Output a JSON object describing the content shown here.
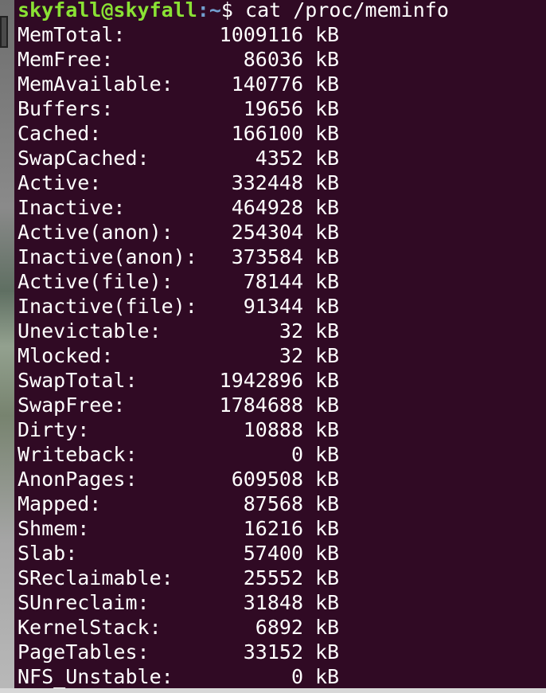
{
  "prompt": {
    "user_host": "skyfall@skyfall",
    "separator": ":",
    "path": "~",
    "symbol": "$",
    "command": " cat /proc/meminfo"
  },
  "meminfo": [
    {
      "key": "MemTotal:",
      "value": "1009116",
      "unit": "kB"
    },
    {
      "key": "MemFree:",
      "value": "86036",
      "unit": "kB"
    },
    {
      "key": "MemAvailable:",
      "value": "140776",
      "unit": "kB"
    },
    {
      "key": "Buffers:",
      "value": "19656",
      "unit": "kB"
    },
    {
      "key": "Cached:",
      "value": "166100",
      "unit": "kB"
    },
    {
      "key": "SwapCached:",
      "value": "4352",
      "unit": "kB"
    },
    {
      "key": "Active:",
      "value": "332448",
      "unit": "kB"
    },
    {
      "key": "Inactive:",
      "value": "464928",
      "unit": "kB"
    },
    {
      "key": "Active(anon):",
      "value": "254304",
      "unit": "kB"
    },
    {
      "key": "Inactive(anon):",
      "value": "373584",
      "unit": "kB"
    },
    {
      "key": "Active(file):",
      "value": "78144",
      "unit": "kB"
    },
    {
      "key": "Inactive(file):",
      "value": "91344",
      "unit": "kB"
    },
    {
      "key": "Unevictable:",
      "value": "32",
      "unit": "kB"
    },
    {
      "key": "Mlocked:",
      "value": "32",
      "unit": "kB"
    },
    {
      "key": "SwapTotal:",
      "value": "1942896",
      "unit": "kB"
    },
    {
      "key": "SwapFree:",
      "value": "1784688",
      "unit": "kB"
    },
    {
      "key": "Dirty:",
      "value": "10888",
      "unit": "kB"
    },
    {
      "key": "Writeback:",
      "value": "0",
      "unit": "kB"
    },
    {
      "key": "AnonPages:",
      "value": "609508",
      "unit": "kB"
    },
    {
      "key": "Mapped:",
      "value": "87568",
      "unit": "kB"
    },
    {
      "key": "Shmem:",
      "value": "16216",
      "unit": "kB"
    },
    {
      "key": "Slab:",
      "value": "57400",
      "unit": "kB"
    },
    {
      "key": "SReclaimable:",
      "value": "25552",
      "unit": "kB"
    },
    {
      "key": "SUnreclaim:",
      "value": "31848",
      "unit": "kB"
    },
    {
      "key": "KernelStack:",
      "value": "6892",
      "unit": "kB"
    },
    {
      "key": "PageTables:",
      "value": "33152",
      "unit": "kB"
    },
    {
      "key": "NFS_Unstable:",
      "value": "0",
      "unit": "kB"
    }
  ],
  "colors": {
    "background": "#300a24",
    "text": "#ffffff",
    "prompt_user": "#8ae234",
    "prompt_path": "#729fcf"
  }
}
